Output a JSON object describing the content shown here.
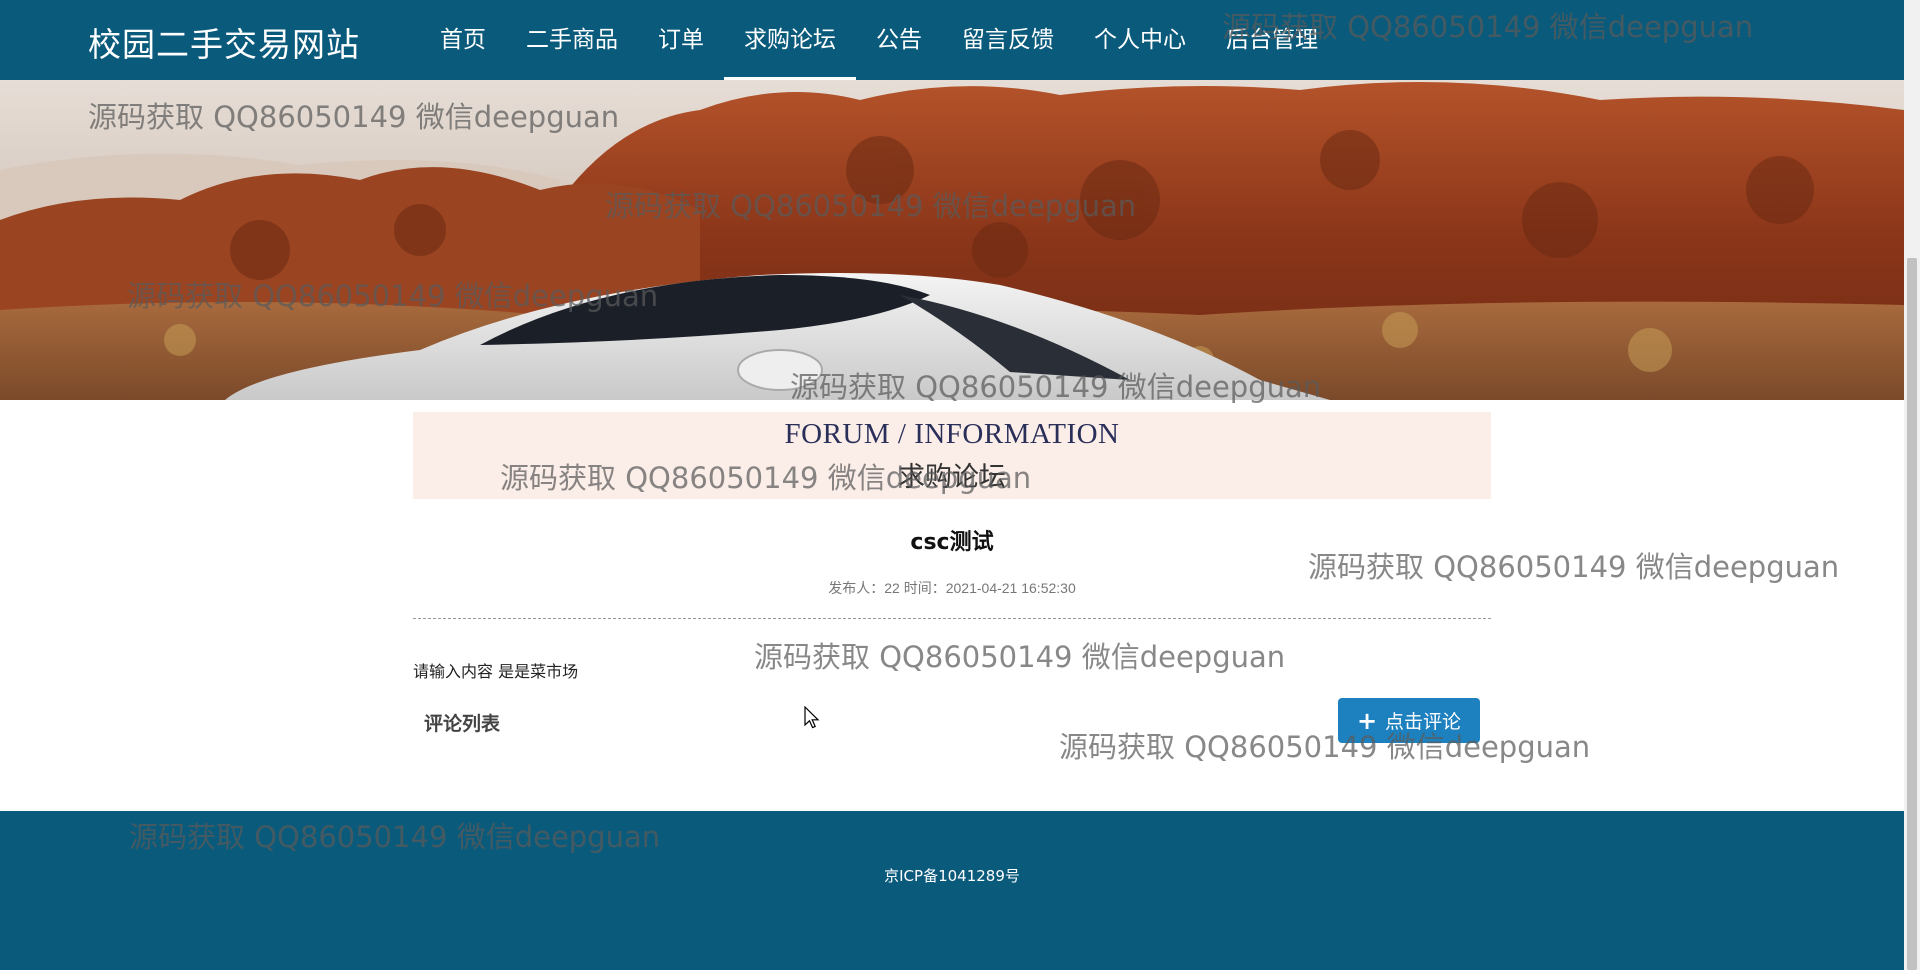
{
  "site": {
    "title": "校园二手交易网站"
  },
  "nav": {
    "items": [
      {
        "label": "首页"
      },
      {
        "label": "二手商品"
      },
      {
        "label": "订单"
      },
      {
        "label": "求购论坛",
        "active": true
      },
      {
        "label": "公告"
      },
      {
        "label": "留言反馈"
      },
      {
        "label": "个人中心"
      },
      {
        "label": "后台管理"
      }
    ]
  },
  "section": {
    "en_title": "FORUM / INFORMATION",
    "zh_title": "求购论坛"
  },
  "post": {
    "title": "csc测试",
    "meta": "发布人：22 时间：2021-04-21 16:52:30",
    "content": "请输入内容  是是菜市场"
  },
  "comments": {
    "title": "评论列表",
    "button_label": "点击评论"
  },
  "footer": {
    "icp": "京ICP备1041289号"
  },
  "watermark": {
    "text": "源码获取 QQ86050149 微信deepguan"
  },
  "colors": {
    "primary": "#0a5a7c",
    "button": "#1d80bf",
    "info_bg": "#fbeee8"
  }
}
